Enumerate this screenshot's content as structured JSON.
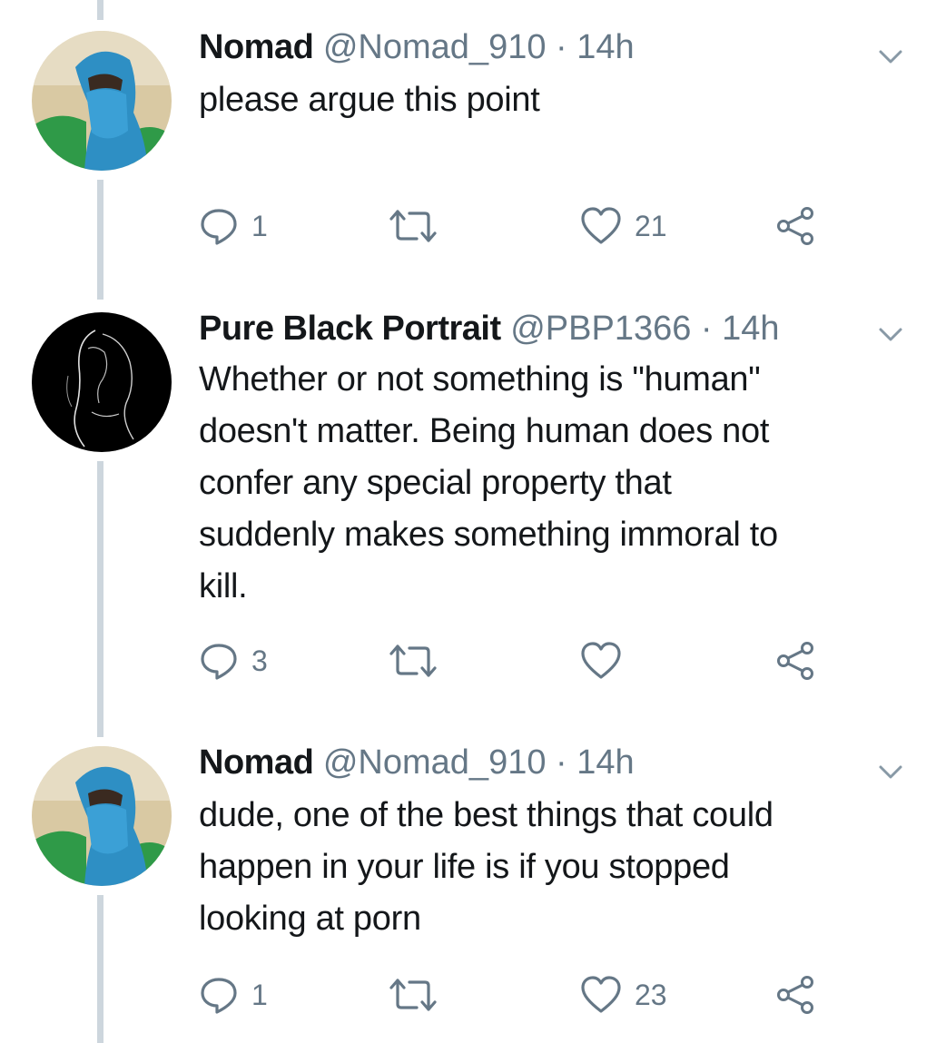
{
  "thread": {
    "tweets": [
      {
        "name": "Nomad",
        "handle": "@Nomad_910",
        "separator": "·",
        "time": "14h",
        "lines": [
          "please argue this point"
        ],
        "avatar": "avatar-nomad-blue-turban",
        "reply_count": "1",
        "retweet_count": "",
        "like_count": "21"
      },
      {
        "name": "Pure Black Portrait",
        "handle": "@PBP1366",
        "separator": "·",
        "time": "14h",
        "lines": [
          "Whether or not something is \"human\"",
          "doesn't matter. Being human does not",
          "confer any special property that",
          "suddenly makes something immoral to",
          "kill."
        ],
        "avatar": "avatar-black-portrait",
        "reply_count": "3",
        "retweet_count": "",
        "like_count": ""
      },
      {
        "name": "Nomad",
        "handle": "@Nomad_910",
        "separator": "·",
        "time": "14h",
        "lines": [
          "dude, one of the best things that could",
          "happen in your life is if you stopped",
          "looking at porn"
        ],
        "avatar": "avatar-nomad-blue-turban",
        "reply_count": "1",
        "retweet_count": "",
        "like_count": "23"
      }
    ]
  },
  "icons": {
    "reply": "reply-icon",
    "retweet": "retweet-icon",
    "like": "heart-icon",
    "share": "share-icon",
    "menu": "chevron-down-icon"
  },
  "colors": {
    "text": "#14171a",
    "secondary": "#657786",
    "thread_line": "#cdd6dd"
  }
}
